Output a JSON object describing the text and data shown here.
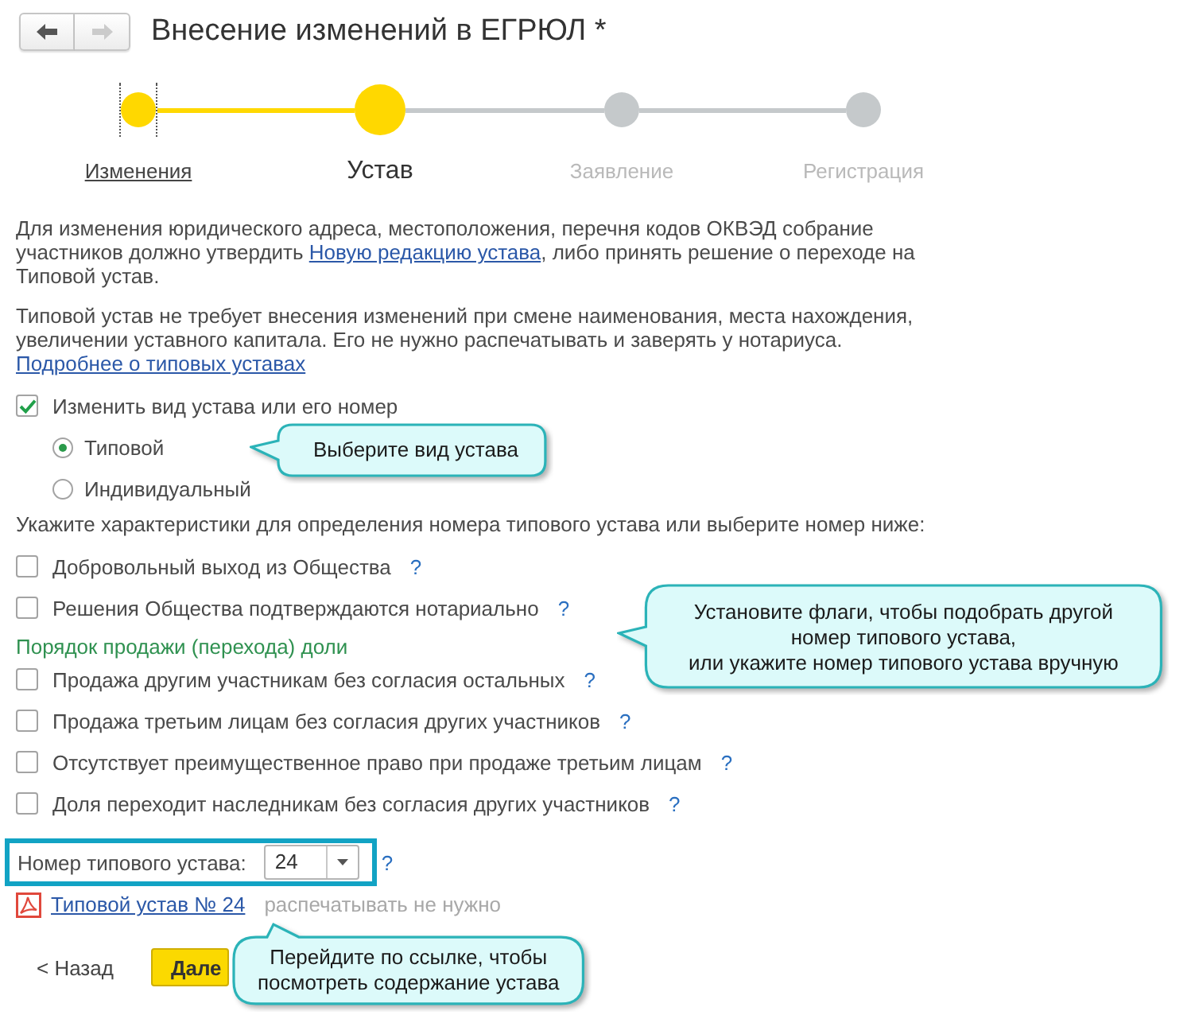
{
  "window": {
    "title": "Внесение изменений в ЕГРЮЛ *"
  },
  "navigation": [
    {
      "kind": "back",
      "disabled": false
    },
    {
      "kind": "forward",
      "disabled": true
    }
  ],
  "steps": [
    {
      "label": "Изменения",
      "completed": true,
      "selected": false,
      "focused": true
    },
    {
      "label": "Устав",
      "completed": false,
      "selected": true,
      "focused": false
    },
    {
      "label": "Заявление",
      "completed": false,
      "selected": false,
      "focused": false
    },
    {
      "label": "Регистрация",
      "completed": false,
      "selected": false,
      "focused": false
    }
  ],
  "paragraphs": [
    {
      "parts": [
        {
          "kind": "text",
          "text": "Для изменения юридического адреса, местоположения, перечня кодов ОКВЭД собрание участников должно утвердить "
        },
        {
          "kind": "link",
          "text": "Новую редакцию устава"
        },
        {
          "kind": "text",
          "text": ", либо принять решение о переходе на Типовой устав."
        }
      ]
    },
    {
      "parts": [
        {
          "kind": "text",
          "text": "Типовой устав не требует внесения изменений при смене наименования, места нахождения, увеличении уставного капитала. Его не нужно распечатывать и заверять у нотариуса."
        }
      ]
    }
  ],
  "more_link": "Подробнее о типовых уставах",
  "change_charter": {
    "label": "Изменить вид устава или его номер",
    "checked": true
  },
  "charter_types": [
    {
      "label": "Типовой",
      "selected": true
    },
    {
      "label": "Индивидуальный",
      "selected": false
    }
  ],
  "criteria_prompt": "Укажите характеристики для определения номера типового устава или выберите номер ниже:",
  "criteria": [
    {
      "kind": "checkbox",
      "label": "Добровольный выход из Общества",
      "checked": false,
      "help": "?"
    },
    {
      "kind": "checkbox",
      "label": "Решения Общества подтверждаются нотариально",
      "checked": false,
      "help": "?"
    },
    {
      "kind": "heading",
      "label": "Порядок продажи (перехода) доли"
    },
    {
      "kind": "checkbox",
      "label": "Продажа другим участникам без согласия остальных",
      "checked": false,
      "help": "?"
    },
    {
      "kind": "checkbox",
      "label": "Продажа третьим лицам без согласия других участников",
      "checked": false,
      "help": "?"
    },
    {
      "kind": "checkbox",
      "label": "Отсутствует преимущественное право при продаже третьим лицам",
      "checked": false,
      "help": "?"
    },
    {
      "kind": "checkbox",
      "label": "Доля переходит наследникам без согласия других участников",
      "checked": false,
      "help": "?"
    }
  ],
  "charter_number": {
    "label": "Номер типового устава:",
    "value": "24",
    "help": "?",
    "highlighted": true
  },
  "charter_link": {
    "text": "Типовой устав № 24",
    "note": "распечатывать не нужно"
  },
  "buttons": [
    {
      "label": "< Назад",
      "kind": "plain"
    },
    {
      "label": "Дале",
      "kind": "primary"
    }
  ],
  "callouts": [
    {
      "kind": "left",
      "text": "Выберите вид устава"
    },
    {
      "kind": "left",
      "text": "Установите флаги, чтобы подобрать другой\nномер типового устава,\nили укажите номер типового устава вручную"
    },
    {
      "kind": "top",
      "text": "Перейдите по ссылке, чтобы\nпосмотреть содержание устава"
    }
  ]
}
